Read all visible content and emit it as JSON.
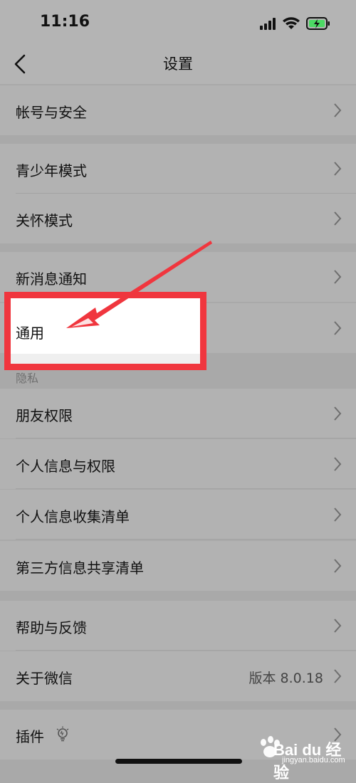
{
  "status_bar": {
    "time": "11:16",
    "icons": [
      "signal-icon",
      "wifi-icon",
      "battery-charging-icon"
    ],
    "battery_color": "#4cd964"
  },
  "nav": {
    "title": "设置"
  },
  "rows": [
    {
      "label": "帐号与安全"
    },
    {
      "label": "青少年模式"
    },
    {
      "label": "关怀模式"
    },
    {
      "label": "新消息通知"
    },
    {
      "label": "通用"
    },
    {
      "label": "朋友权限"
    },
    {
      "label": "个人信息与权限"
    },
    {
      "label": "个人信息收集清单"
    },
    {
      "label": "第三方信息共享清单"
    },
    {
      "label": "帮助与反馈"
    },
    {
      "label": "关于微信",
      "value": "版本 8.0.18"
    },
    {
      "label": "插件"
    }
  ],
  "section_headers": {
    "privacy": "隐私"
  },
  "annotation": {
    "highlight_color": "#f0363e",
    "highlighted_row": "通用"
  },
  "watermark": {
    "brand": "Bai du 经验",
    "site": "jingyan.baidu.com"
  }
}
